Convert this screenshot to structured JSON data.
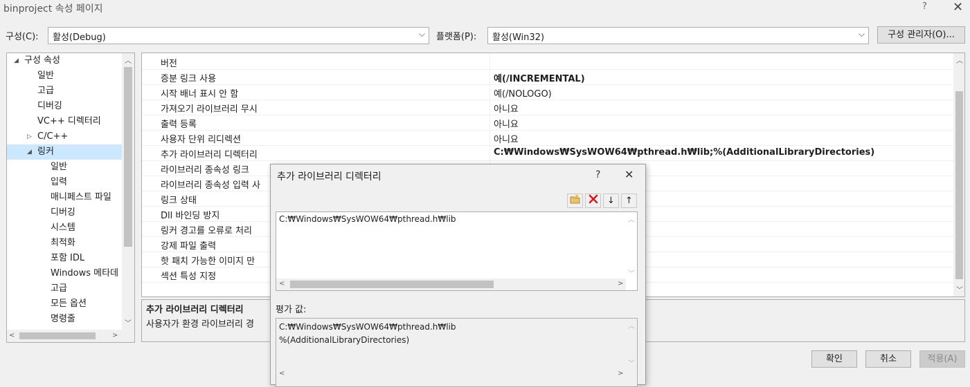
{
  "window": {
    "title": "binproject 속성 페이지",
    "help": "?",
    "close": "✕"
  },
  "config_bar": {
    "config_label": "구성(C):",
    "config_value": "활성(Debug)",
    "platform_label": "플랫폼(P):",
    "platform_value": "활성(Win32)",
    "manager_button": "구성 관리자(O)..."
  },
  "tree": {
    "items": [
      {
        "label": "구성 속성",
        "arrow": "◢"
      },
      {
        "label": "일반"
      },
      {
        "label": "고급"
      },
      {
        "label": "디버깅"
      },
      {
        "label": "VC++ 디렉터리"
      },
      {
        "label": "C/C++",
        "arrow": "▷"
      },
      {
        "label": "링커",
        "arrow": "◢"
      },
      {
        "label": "일반"
      },
      {
        "label": "입력"
      },
      {
        "label": "매니페스트 파일"
      },
      {
        "label": "디버깅"
      },
      {
        "label": "시스템"
      },
      {
        "label": "최적화"
      },
      {
        "label": "포함 IDL"
      },
      {
        "label": "Windows 메타데"
      },
      {
        "label": "고급"
      },
      {
        "label": "모든 옵션"
      },
      {
        "label": "명령줄"
      }
    ]
  },
  "grid": {
    "rows": [
      {
        "name": "버전",
        "value": ""
      },
      {
        "name": "증분 링크 사용",
        "value": "예(/INCREMENTAL)"
      },
      {
        "name": "시작 배너 표시 안 함",
        "value": "예(/NOLOGO)"
      },
      {
        "name": "가져오기 라이브러리 무시",
        "value": "아니요"
      },
      {
        "name": "출력 등록",
        "value": "아니요"
      },
      {
        "name": "사용자 단위 리디렉션",
        "value": "아니요"
      },
      {
        "name": "추가 라이브러리 디렉터리",
        "value": "C:₩Windows₩SysWOW64₩pthread.h₩lib;%(AdditionalLibraryDirectories)"
      },
      {
        "name": "라이브러리 종속성 링크",
        "value": ""
      },
      {
        "name": "라이브러리 종속성 입력 사",
        "value": ""
      },
      {
        "name": "링크 상태",
        "value": ""
      },
      {
        "name": "Dll 바인딩 방지",
        "value": ""
      },
      {
        "name": "링커 경고를 오류로 처리",
        "value": ""
      },
      {
        "name": "강제 파일 출력",
        "value": ""
      },
      {
        "name": "핫 패치 가능한 이미지 만",
        "value": ""
      },
      {
        "name": "섹션 특성 지정",
        "value": ""
      }
    ]
  },
  "description": {
    "title": "추가 라이브러리 디렉터리",
    "text": "사용자가 환경 라이브러리 경"
  },
  "buttons": {
    "ok": "확인",
    "cancel": "취소",
    "apply": "적용(A)"
  },
  "subdialog": {
    "title": "추가 라이브러리 디렉터리",
    "help": "?",
    "close": "✕",
    "toolbar": {
      "new": "new-folder-icon",
      "delete": "delete-icon",
      "down": "↓",
      "up": "↑"
    },
    "edit_value": "C:₩Windows₩SysWOW64₩pthread.h₩lib",
    "eval_label": "평가 값:",
    "eval_lines": [
      "C:₩Windows₩SysWOW64₩pthread.h₩lib",
      "%(AdditionalLibraryDirectories)"
    ]
  },
  "colors": {
    "accent_selection": "#cce8ff",
    "delete_red": "#d7191c"
  }
}
